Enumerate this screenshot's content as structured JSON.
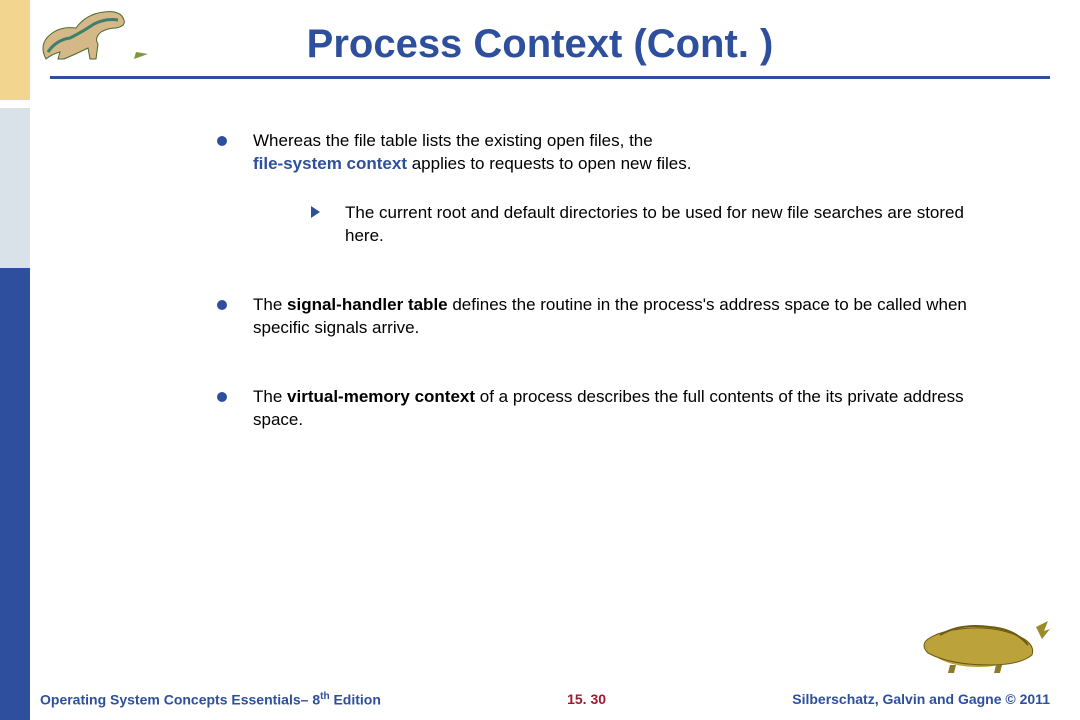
{
  "title": "Process Context (Cont. )",
  "bullets": {
    "b1_pre": "Whereas the file table lists the existing open files, the ",
    "b1_term": "file-system context",
    "b1_post": " applies to requests to open new files.",
    "b1_sub": "The current root and default directories to be used for new file searches are stored here.",
    "b2_pre": "The ",
    "b2_term": "signal-handler table",
    "b2_post": " defines the routine in the process's address space to be called when specific signals arrive.",
    "b3_pre": "The ",
    "b3_term": "virtual-memory context",
    "b3_post": " of a process describes the full contents of the its private address space."
  },
  "footer": {
    "left_pre": "Operating System Concepts Essentials– 8",
    "left_sup": "th",
    "left_post": " Edition",
    "page": "15. 30",
    "right": "Silberschatz, Galvin and Gagne © 2011"
  }
}
